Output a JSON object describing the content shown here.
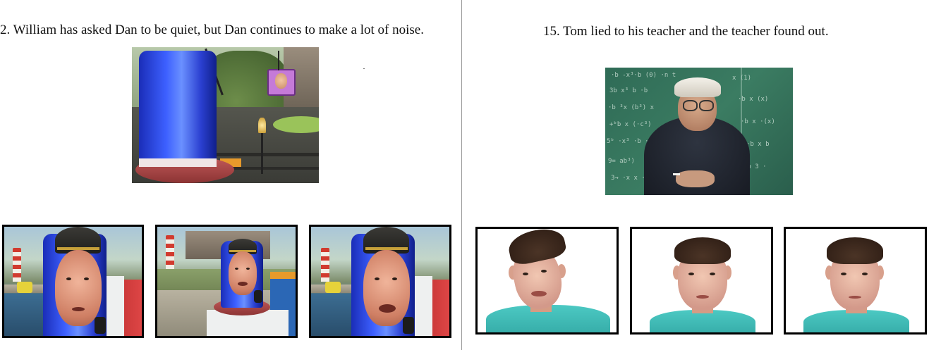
{
  "left_panel": {
    "caption": "2. William has asked Dan to be quiet, but Dan continues to make a lot of noise."
  },
  "right_panel": {
    "caption": "15. Tom lied to his teacher and the teacher found out."
  },
  "colors": {
    "divider": "#9a9a9a",
    "pod_blue": "#3d60ff",
    "chalkboard": "#3b7c62",
    "shirt_teal": "#4cc9c3"
  }
}
